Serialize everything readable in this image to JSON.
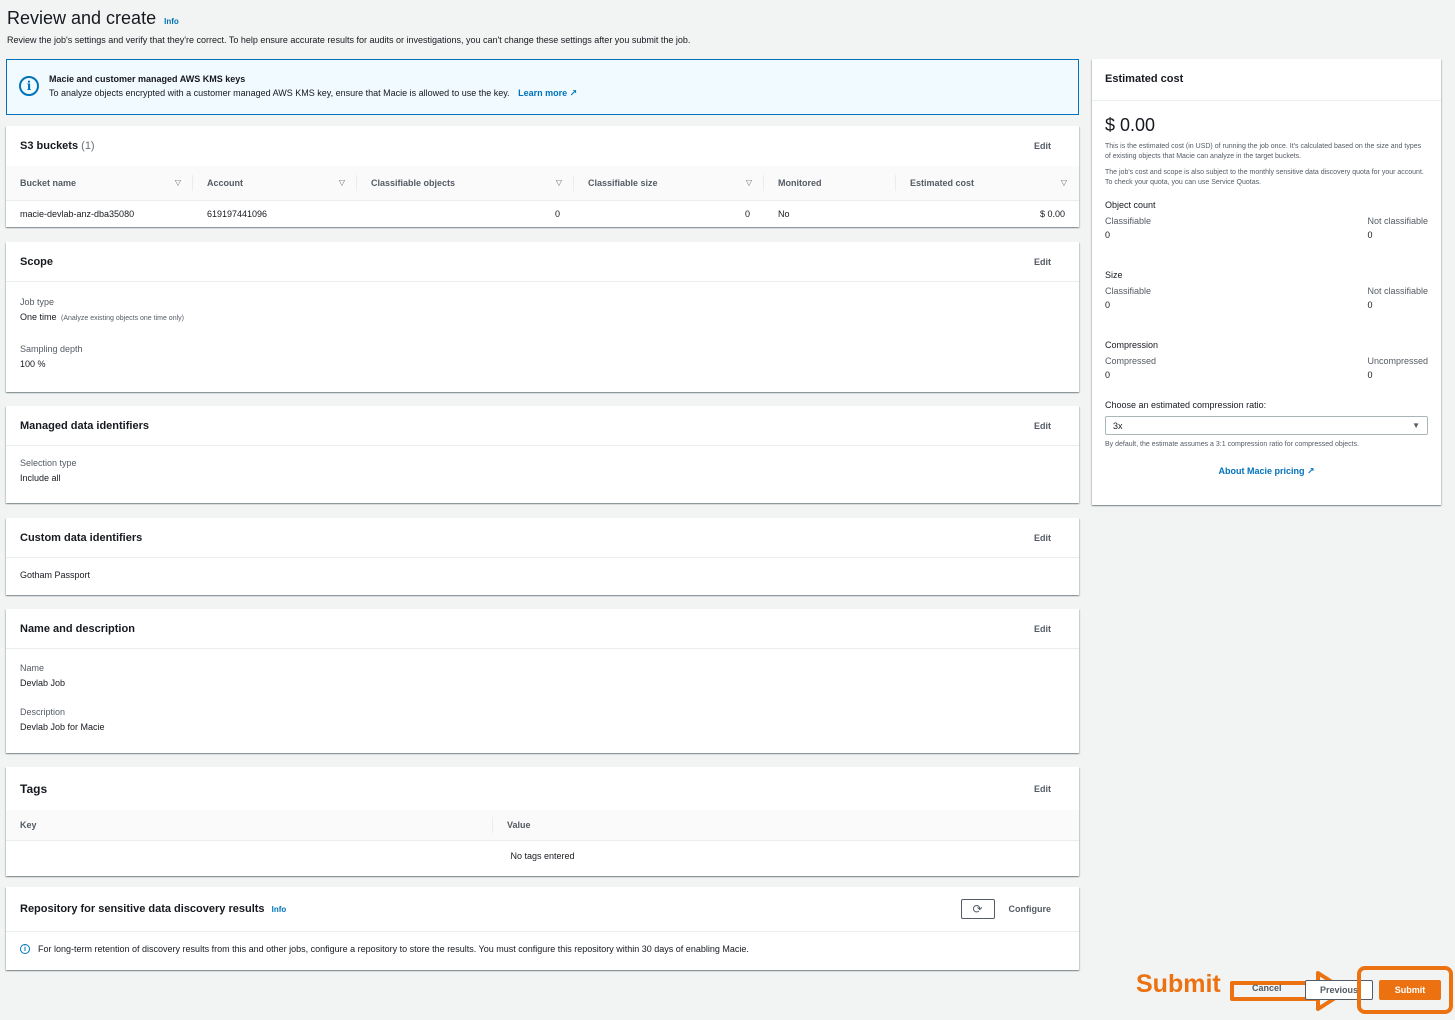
{
  "header": {
    "title": "Review and create",
    "info": "Info",
    "description": "Review the job's settings and verify that they're correct. To help ensure accurate results for audits or investigations, you can't change these settings after you submit the job."
  },
  "kms_flash": {
    "title": "Macie and customer managed AWS KMS keys",
    "text": "To analyze objects encrypted with a customer managed AWS KMS key, ensure that Macie is allowed to use the key.",
    "link": "Learn more"
  },
  "edit_label": "Edit",
  "s3": {
    "title": "S3 buckets",
    "count": "(1)",
    "columns": [
      "Bucket name",
      "Account",
      "Classifiable objects",
      "Classifiable size",
      "Monitored",
      "Estimated cost"
    ],
    "rows": [
      {
        "bucket": "macie-devlab-anz-dba35080",
        "account": "619197441096",
        "objects": "0",
        "size": "0",
        "monitored": "No",
        "cost": "$ 0.00"
      }
    ]
  },
  "scope": {
    "title": "Scope",
    "job_type_label": "Job type",
    "job_type_value": "One time",
    "job_type_note": "(Analyze existing objects one time only)",
    "sampling_label": "Sampling depth",
    "sampling_value": "100 %"
  },
  "managed": {
    "title": "Managed data identifiers",
    "selection_label": "Selection type",
    "selection_value": "Include all"
  },
  "custom": {
    "title": "Custom data identifiers",
    "value": "Gotham Passport"
  },
  "name_desc": {
    "title": "Name and description",
    "name_label": "Name",
    "name_value": "Devlab Job",
    "desc_label": "Description",
    "desc_value": "Devlab Job for Macie"
  },
  "tags": {
    "title": "Tags",
    "key_col": "Key",
    "value_col": "Value",
    "empty": "No tags entered"
  },
  "repository": {
    "title": "Repository for sensitive data discovery results",
    "info": "Info",
    "configure": "Configure",
    "message": "For long-term retention of discovery results from this and other jobs, configure a repository to store the results. You must configure this repository within 30 days of enabling Macie."
  },
  "cost_panel": {
    "title": "Estimated cost",
    "amount": "$ 0.00",
    "note1": "This is the estimated cost (in USD) of running the job once. It's calculated based on the size and types of existing objects that Macie can analyze in the target buckets.",
    "note2": "The job's cost and scope is also subject to the monthly sensitive data discovery quota for your account. To check your quota, you can use Service Quotas.",
    "object_count": {
      "title": "Object count",
      "left_label": "Classifiable",
      "left_value": "0",
      "right_label": "Not classifiable",
      "right_value": "0"
    },
    "size": {
      "title": "Size",
      "left_label": "Classifiable",
      "left_value": "0",
      "right_label": "Not classifiable",
      "right_value": "0"
    },
    "compression": {
      "title": "Compression",
      "left_label": "Compressed",
      "left_value": "0",
      "right_label": "Uncompressed",
      "right_value": "0"
    },
    "ratio_label": "Choose an estimated compression ratio:",
    "ratio_value": "3x",
    "ratio_note": "By default, the estimate assumes a 3:1 compression ratio for compressed objects.",
    "pricing_link": "About Macie pricing"
  },
  "footer": {
    "annotation": "Submit",
    "cancel": "Cancel",
    "previous": "Previous",
    "submit": "Submit",
    "accent": "#ec7211"
  }
}
